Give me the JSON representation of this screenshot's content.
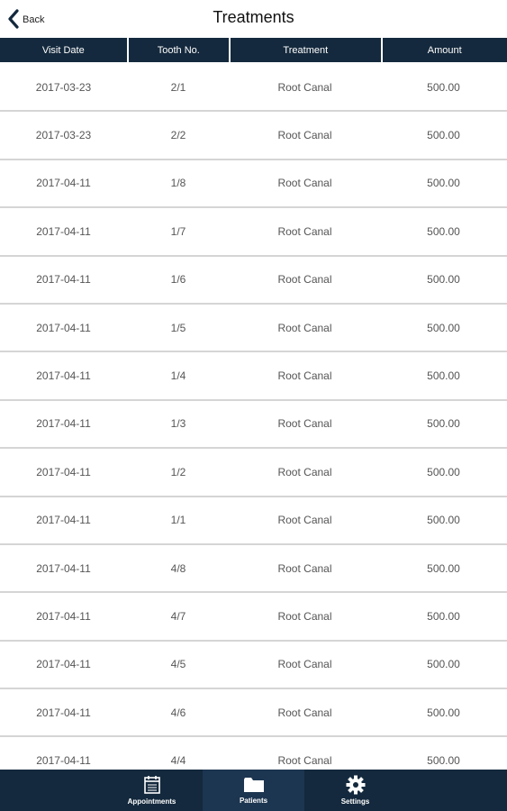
{
  "header": {
    "back_label": "Back",
    "title": "Treatments"
  },
  "columns": [
    "Visit Date",
    "Tooth No.",
    "Treatment",
    "Amount"
  ],
  "rows": [
    {
      "date": "2017-03-23",
      "tooth": "2/1",
      "treatment": "Root Canal",
      "amount": "500.00"
    },
    {
      "date": "2017-03-23",
      "tooth": "2/2",
      "treatment": "Root Canal",
      "amount": "500.00"
    },
    {
      "date": "2017-04-11",
      "tooth": "1/8",
      "treatment": "Root Canal",
      "amount": "500.00"
    },
    {
      "date": "2017-04-11",
      "tooth": "1/7",
      "treatment": "Root Canal",
      "amount": "500.00"
    },
    {
      "date": "2017-04-11",
      "tooth": "1/6",
      "treatment": "Root Canal",
      "amount": "500.00"
    },
    {
      "date": "2017-04-11",
      "tooth": "1/5",
      "treatment": "Root Canal",
      "amount": "500.00"
    },
    {
      "date": "2017-04-11",
      "tooth": "1/4",
      "treatment": "Root Canal",
      "amount": "500.00"
    },
    {
      "date": "2017-04-11",
      "tooth": "1/3",
      "treatment": "Root Canal",
      "amount": "500.00"
    },
    {
      "date": "2017-04-11",
      "tooth": "1/2",
      "treatment": "Root Canal",
      "amount": "500.00"
    },
    {
      "date": "2017-04-11",
      "tooth": "1/1",
      "treatment": "Root Canal",
      "amount": "500.00"
    },
    {
      "date": "2017-04-11",
      "tooth": "4/8",
      "treatment": "Root Canal",
      "amount": "500.00"
    },
    {
      "date": "2017-04-11",
      "tooth": "4/7",
      "treatment": "Root Canal",
      "amount": "500.00"
    },
    {
      "date": "2017-04-11",
      "tooth": "4/5",
      "treatment": "Root Canal",
      "amount": "500.00"
    },
    {
      "date": "2017-04-11",
      "tooth": "4/6",
      "treatment": "Root Canal",
      "amount": "500.00"
    },
    {
      "date": "2017-04-11",
      "tooth": "4/4",
      "treatment": "Root Canal",
      "amount": "500.00"
    }
  ],
  "tabbar": {
    "items": [
      {
        "label": "Appointments",
        "icon": "calendar-icon"
      },
      {
        "label": "Patients",
        "icon": "folder-icon"
      },
      {
        "label": "Settings",
        "icon": "gear-icon"
      }
    ],
    "active": "Patients"
  },
  "colors": {
    "header_bg": "#14293d",
    "active_tab_bg": "#1c3550",
    "row_divider": "#d5d5d5"
  }
}
